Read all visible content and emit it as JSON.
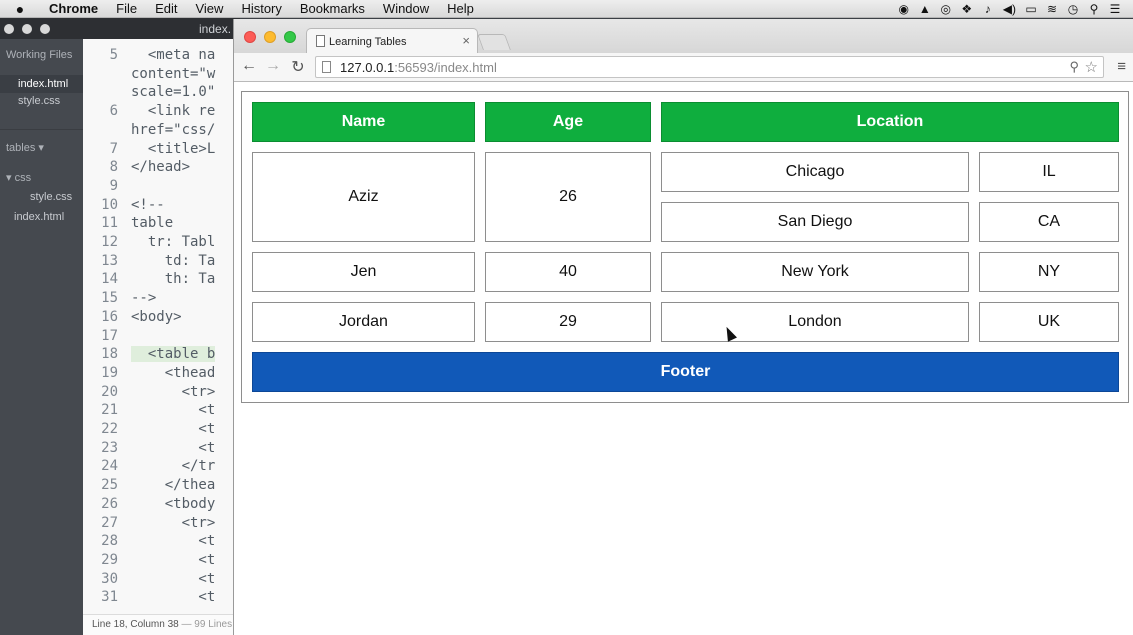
{
  "menubar": {
    "apple": "",
    "items": [
      "Chrome",
      "File",
      "Edit",
      "View",
      "History",
      "Bookmarks",
      "Window",
      "Help"
    ],
    "status_icons": [
      "stop-record-icon",
      "drive-icon",
      "creative-cloud-icon",
      "dropbox-icon",
      "bell-icon",
      "volume-icon",
      "battery-icon",
      "wifi-icon",
      "time-machine-icon",
      "spotlight-icon",
      "notification-center-icon"
    ]
  },
  "editor": {
    "window_title": "index.",
    "sidebar": {
      "working_files_label": "Working Files",
      "working_files": [
        "index.html",
        "style.css"
      ],
      "project_label": "tables ▾",
      "folder": "▾ css",
      "folder_files": [
        "style.css"
      ],
      "root_files": [
        "index.html"
      ]
    },
    "code_lines": [
      {
        "n": "5",
        "text": "  <meta na"
      },
      {
        "n": "",
        "text": "content=\"w"
      },
      {
        "n": "",
        "text": "scale=1.0\""
      },
      {
        "n": "6",
        "text": "  <link re"
      },
      {
        "n": "",
        "text": "href=\"css/"
      },
      {
        "n": "7",
        "text": "  <title>L"
      },
      {
        "n": "8",
        "text": "</head>"
      },
      {
        "n": "9",
        "text": ""
      },
      {
        "n": "10",
        "text": "<!--"
      },
      {
        "n": "11",
        "text": "table"
      },
      {
        "n": "12",
        "text": "  tr: Tabl"
      },
      {
        "n": "13",
        "text": "    td: Ta"
      },
      {
        "n": "14",
        "text": "    th: Ta"
      },
      {
        "n": "15",
        "text": "-->"
      },
      {
        "n": "16",
        "text": "<body>"
      },
      {
        "n": "17",
        "text": ""
      },
      {
        "n": "18",
        "text": "  <table b"
      },
      {
        "n": "19",
        "text": "    <thead"
      },
      {
        "n": "20",
        "text": "      <tr>"
      },
      {
        "n": "21",
        "text": "        <t"
      },
      {
        "n": "22",
        "text": "        <t"
      },
      {
        "n": "23",
        "text": "        <t"
      },
      {
        "n": "24",
        "text": "      </tr"
      },
      {
        "n": "25",
        "text": "    </thea"
      },
      {
        "n": "26",
        "text": "    <tbody"
      },
      {
        "n": "27",
        "text": "      <tr>"
      },
      {
        "n": "28",
        "text": "        <t"
      },
      {
        "n": "29",
        "text": "        <t"
      },
      {
        "n": "30",
        "text": "        <t"
      },
      {
        "n": "31",
        "text": "        <t"
      }
    ],
    "status": {
      "position": "Line 18, Column 38",
      "lines": " — 99 Lines"
    }
  },
  "chrome": {
    "tab_title": "Learning Tables",
    "tab_close": "×",
    "url_host": "127.0.0.1",
    "url_path": ":56593/index.html",
    "back_icon": "←",
    "forward_icon": "→",
    "reload_icon": "↻",
    "zoom_icon": "⚲",
    "star_icon": "☆",
    "menu_icon": "≡"
  },
  "table": {
    "headers": [
      "Name",
      "Age",
      "Location"
    ],
    "rows": [
      {
        "name": "Aziz",
        "age": "26",
        "locations": [
          {
            "city": "Chicago",
            "state": "IL"
          },
          {
            "city": "San Diego",
            "state": "CA"
          }
        ]
      },
      {
        "name": "Jen",
        "age": "40",
        "locations": [
          {
            "city": "New York",
            "state": "NY"
          }
        ]
      },
      {
        "name": "Jordan",
        "age": "29",
        "locations": [
          {
            "city": "London",
            "state": "UK"
          }
        ]
      }
    ],
    "footer": "Footer",
    "colors": {
      "header_bg": "#0fae3e",
      "footer_bg": "#1159b8",
      "border": "#8e8e8e"
    }
  }
}
